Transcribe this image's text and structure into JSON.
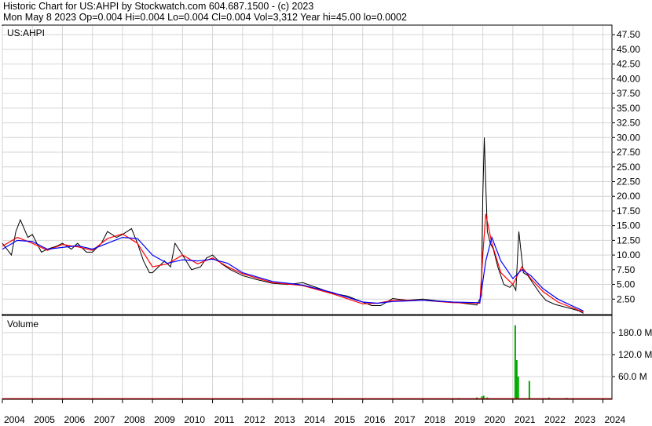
{
  "header": {
    "line1": "Historic Chart for US:AHPI by Stockwatch.com 604.687.1500 - (c) 2023",
    "line2": "Mon May  8 2023   Op=0.004   Hi=0.004   Lo=0.004   Cl=0.004   Vol=3,312   Year hi=45.00   lo=0.0002"
  },
  "chart_data": [
    {
      "type": "line",
      "title": "US:AHPI",
      "ylim": [
        0,
        49
      ],
      "y_ticks": [
        "2.50",
        "5.00",
        "7.50",
        "10.00",
        "12.50",
        "15.00",
        "17.50",
        "20.00",
        "22.50",
        "25.00",
        "27.50",
        "30.00",
        "32.50",
        "35.00",
        "37.50",
        "40.00",
        "42.50",
        "45.00",
        "47.50"
      ],
      "x_ticks": [
        "2004",
        "2005",
        "2006",
        "2007",
        "2008",
        "2009",
        "2010",
        "2011",
        "2012",
        "2013",
        "2014",
        "2015",
        "2016",
        "2017",
        "2018",
        "2019",
        "2020",
        "2021",
        "2022",
        "2023",
        "2024"
      ],
      "series": [
        {
          "color": "#000000",
          "x": [
            2004.0,
            2004.3,
            2004.45,
            2004.6,
            2004.85,
            2005.0,
            2005.3,
            2005.5,
            2005.8,
            2006.0,
            2006.3,
            2006.5,
            2006.8,
            2007.0,
            2007.3,
            2007.5,
            2007.8,
            2008.0,
            2008.3,
            2008.5,
            2008.7,
            2008.9,
            2009.0,
            2009.2,
            2009.4,
            2009.6,
            2009.75,
            2010.0,
            2010.3,
            2010.6,
            2010.8,
            2011.0,
            2011.3,
            2011.6,
            2012.0,
            2012.5,
            2013.0,
            2013.5,
            2014.0,
            2014.5,
            2015.0,
            2015.5,
            2016.0,
            2016.3,
            2016.6,
            2017.0,
            2017.5,
            2018.0,
            2018.5,
            2019.0,
            2019.5,
            2019.8,
            2019.95,
            2020.0,
            2020.05,
            2020.1,
            2020.15,
            2020.25,
            2020.35,
            2020.5,
            2020.7,
            2020.9,
            2021.0,
            2021.1,
            2021.2,
            2021.35,
            2021.5,
            2021.7,
            2021.9,
            2022.1,
            2022.4,
            2022.7,
            2023.0,
            2023.2,
            2023.35
          ],
          "values": [
            12,
            10,
            14,
            16,
            13,
            13.5,
            10.5,
            11,
            11.5,
            12,
            11,
            12,
            10.5,
            10.5,
            12,
            14,
            13,
            13.5,
            14.5,
            12,
            9,
            7,
            7,
            8,
            9,
            8,
            12,
            10,
            7.5,
            8,
            9.5,
            10,
            8.5,
            7.5,
            6.5,
            5.8,
            5.2,
            5,
            5.3,
            4.4,
            3.5,
            3,
            2,
            1.4,
            1.4,
            2.6,
            2.3,
            2.5,
            2.2,
            2,
            1.7,
            1.5,
            3,
            20,
            30,
            22,
            14,
            12,
            11,
            8,
            5,
            4.5,
            5,
            4,
            14,
            7,
            6.5,
            5,
            3.5,
            2.3,
            1.6,
            1.2,
            0.8,
            0.5,
            0.1
          ]
        },
        {
          "color": "#ff0000",
          "x": [
            2004.0,
            2004.5,
            2005.0,
            2005.5,
            2006.0,
            2006.5,
            2007.0,
            2007.5,
            2008.0,
            2008.5,
            2009.0,
            2009.5,
            2010.0,
            2010.5,
            2011.0,
            2011.5,
            2012.0,
            2013.0,
            2014.0,
            2015.0,
            2016.0,
            2016.5,
            2017.0,
            2018.0,
            2019.0,
            2019.9,
            2020.0,
            2020.1,
            2020.3,
            2020.6,
            2021.0,
            2021.3,
            2021.6,
            2022.0,
            2022.5,
            2023.0,
            2023.35
          ],
          "values": [
            11.5,
            13,
            12,
            10.8,
            11.8,
            11.4,
            10.8,
            12.8,
            13.6,
            12,
            8,
            8.5,
            10,
            8.5,
            9.5,
            8,
            6.8,
            5.3,
            4.8,
            3.4,
            1.7,
            1.8,
            2.3,
            2.3,
            1.9,
            1.8,
            10,
            17,
            12,
            7,
            5,
            8,
            6,
            3.8,
            2,
            1,
            0.3
          ]
        },
        {
          "color": "#0000ff",
          "x": [
            2004.0,
            2004.5,
            2005.0,
            2005.5,
            2006.0,
            2006.5,
            2007.0,
            2007.5,
            2008.0,
            2008.5,
            2009.0,
            2009.5,
            2010.0,
            2010.5,
            2011.0,
            2011.5,
            2012.0,
            2013.0,
            2014.0,
            2015.0,
            2016.0,
            2016.5,
            2017.0,
            2018.0,
            2019.0,
            2019.9,
            2020.1,
            2020.3,
            2020.6,
            2021.0,
            2021.3,
            2021.6,
            2022.0,
            2022.5,
            2023.0,
            2023.35
          ],
          "values": [
            11,
            12.5,
            12.3,
            11,
            11.3,
            11.6,
            11,
            12,
            13,
            12.8,
            10,
            8.6,
            9.2,
            9,
            9.3,
            8.6,
            7,
            5.5,
            4.9,
            3.6,
            2,
            1.8,
            2.1,
            2.3,
            2,
            1.9,
            9,
            13,
            9,
            6,
            7.5,
            6.5,
            4.3,
            2.5,
            1.3,
            0.5
          ]
        }
      ]
    },
    {
      "type": "bar",
      "title": "Volume",
      "ylim": [
        0,
        225
      ],
      "y_ticks": [
        "60.0 M",
        "120.0 M",
        "180.0 M"
      ],
      "x": [
        2004.1,
        2004.6,
        2005.2,
        2005.9,
        2006.5,
        2007.2,
        2008.0,
        2008.6,
        2009.3,
        2010.0,
        2010.7,
        2011.4,
        2012.2,
        2013.0,
        2013.8,
        2014.5,
        2015.2,
        2016.0,
        2016.7,
        2017.3,
        2018.0,
        2018.6,
        2019.2,
        2019.8,
        2019.97,
        2020.03,
        2020.15,
        2021.08,
        2021.13,
        2021.18,
        2021.55,
        2022.2,
        2022.8
      ],
      "values": [
        1,
        1,
        0.8,
        0.8,
        0.8,
        0.8,
        1,
        1,
        1,
        1.2,
        1,
        1,
        1,
        0.8,
        0.8,
        0.8,
        0.8,
        1,
        1,
        1,
        1,
        1,
        1.5,
        3,
        6,
        8,
        3,
        200,
        105,
        60,
        48,
        3,
        2
      ]
    }
  ]
}
